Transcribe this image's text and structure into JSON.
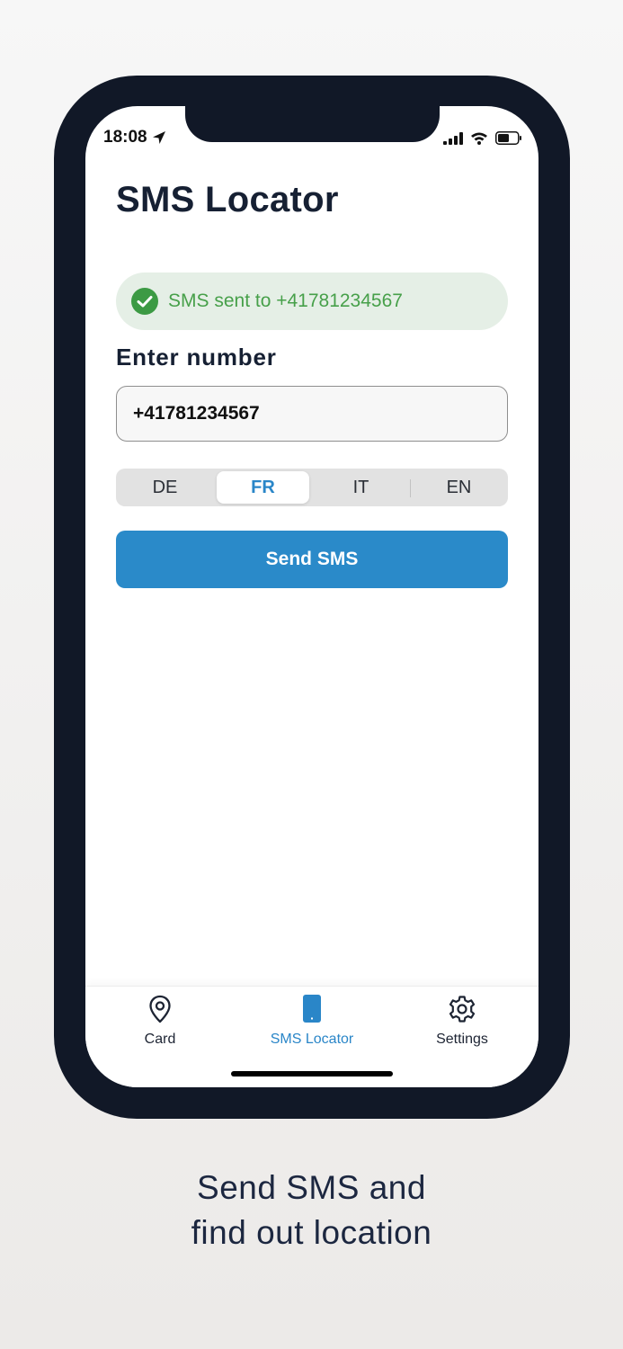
{
  "status_bar": {
    "time": "18:08"
  },
  "screen": {
    "title": "SMS Locator",
    "toast": {
      "message": "SMS sent to +41781234567",
      "icon": "check-circle-icon",
      "color": "#47a04a"
    },
    "number_field": {
      "label": "Enter number",
      "value": "+41781234567"
    },
    "language_selector": {
      "options": [
        "DE",
        "FR",
        "IT",
        "EN"
      ],
      "selected": "FR"
    },
    "send_button": {
      "label": "Send SMS",
      "color": "#2a8ac9"
    }
  },
  "tab_bar": {
    "items": [
      {
        "label": "Card",
        "icon": "map-pin-icon",
        "active": false
      },
      {
        "label": "SMS Locator",
        "icon": "phone-icon",
        "active": true
      },
      {
        "label": "Settings",
        "icon": "gear-icon",
        "active": false
      }
    ],
    "active_color": "#2a86c8"
  },
  "caption": {
    "line1": "Send SMS and",
    "line2": "find out location"
  }
}
